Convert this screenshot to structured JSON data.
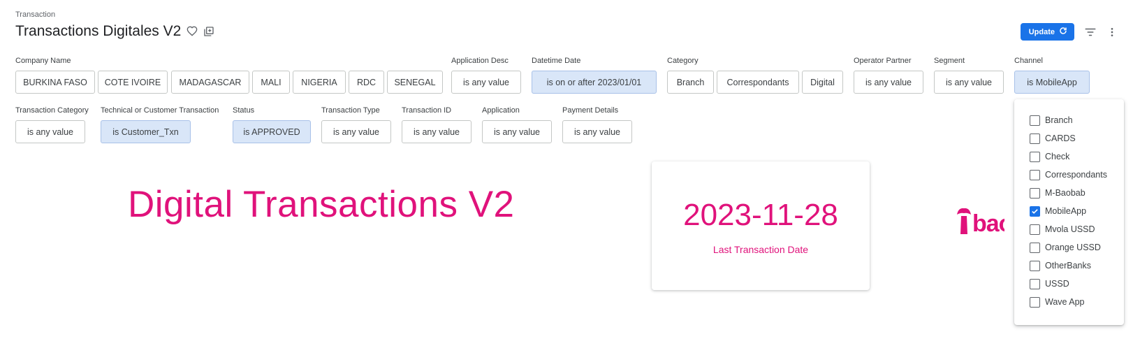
{
  "header": {
    "breadcrumb": "Transaction",
    "title": "Transactions Digitales V2",
    "update_label": "Update",
    "icons": [
      "heart-icon",
      "copy-icon",
      "refresh-icon",
      "filter-icon",
      "more-vert-icon"
    ]
  },
  "filters": {
    "company": {
      "label": "Company Name",
      "values": [
        "BURKINA FASO",
        "COTE IVOIRE",
        "MADAGASCAR",
        "MALI",
        "NIGERIA",
        "RDC",
        "SENEGAL"
      ]
    },
    "application_desc": {
      "label": "Application Desc",
      "value": "is any value"
    },
    "datetime_date": {
      "label": "Datetime Date",
      "value": "is on or after 2023/01/01"
    },
    "category": {
      "label": "Category",
      "values": [
        "Branch",
        "Correspondants",
        "Digital"
      ]
    },
    "operator_partner": {
      "label": "Operator Partner",
      "value": "is any value"
    },
    "segment": {
      "label": "Segment",
      "value": "is any value"
    },
    "channel": {
      "label": "Channel",
      "value": "is MobileApp"
    },
    "transaction_category": {
      "label": "Transaction Category",
      "value": "is any value"
    },
    "technical_customer": {
      "label": "Technical or Customer Transaction",
      "value": "is Customer_Txn"
    },
    "status": {
      "label": "Status",
      "value": "is APPROVED"
    },
    "transaction_type": {
      "label": "Transaction Type",
      "value": "is any value"
    },
    "transaction_id": {
      "label": "Transaction ID",
      "value": "is any value"
    },
    "application": {
      "label": "Application",
      "value": "is any value"
    },
    "payment_details": {
      "label": "Payment Details",
      "value": "is any value"
    }
  },
  "dashboard": {
    "big_title": "Digital Transactions V2",
    "kpi_value": "2023-11-28",
    "kpi_label": "Last Transaction Date",
    "logo_text": "bao"
  },
  "channel_dropdown": {
    "options": [
      {
        "label": "Branch",
        "checked": false
      },
      {
        "label": "CARDS",
        "checked": false
      },
      {
        "label": "Check",
        "checked": false
      },
      {
        "label": "Correspondants",
        "checked": false
      },
      {
        "label": "M-Baobab",
        "checked": false
      },
      {
        "label": "MobileApp",
        "checked": true
      },
      {
        "label": "Mvola USSD",
        "checked": false
      },
      {
        "label": "Orange USSD",
        "checked": false
      },
      {
        "label": "OtherBanks",
        "checked": false
      },
      {
        "label": "USSD",
        "checked": false
      },
      {
        "label": "Wave App",
        "checked": false
      }
    ]
  },
  "colors": {
    "accent": "#e0127b",
    "primary": "#1a73e8",
    "selected_chip": "#d9e6f8"
  }
}
